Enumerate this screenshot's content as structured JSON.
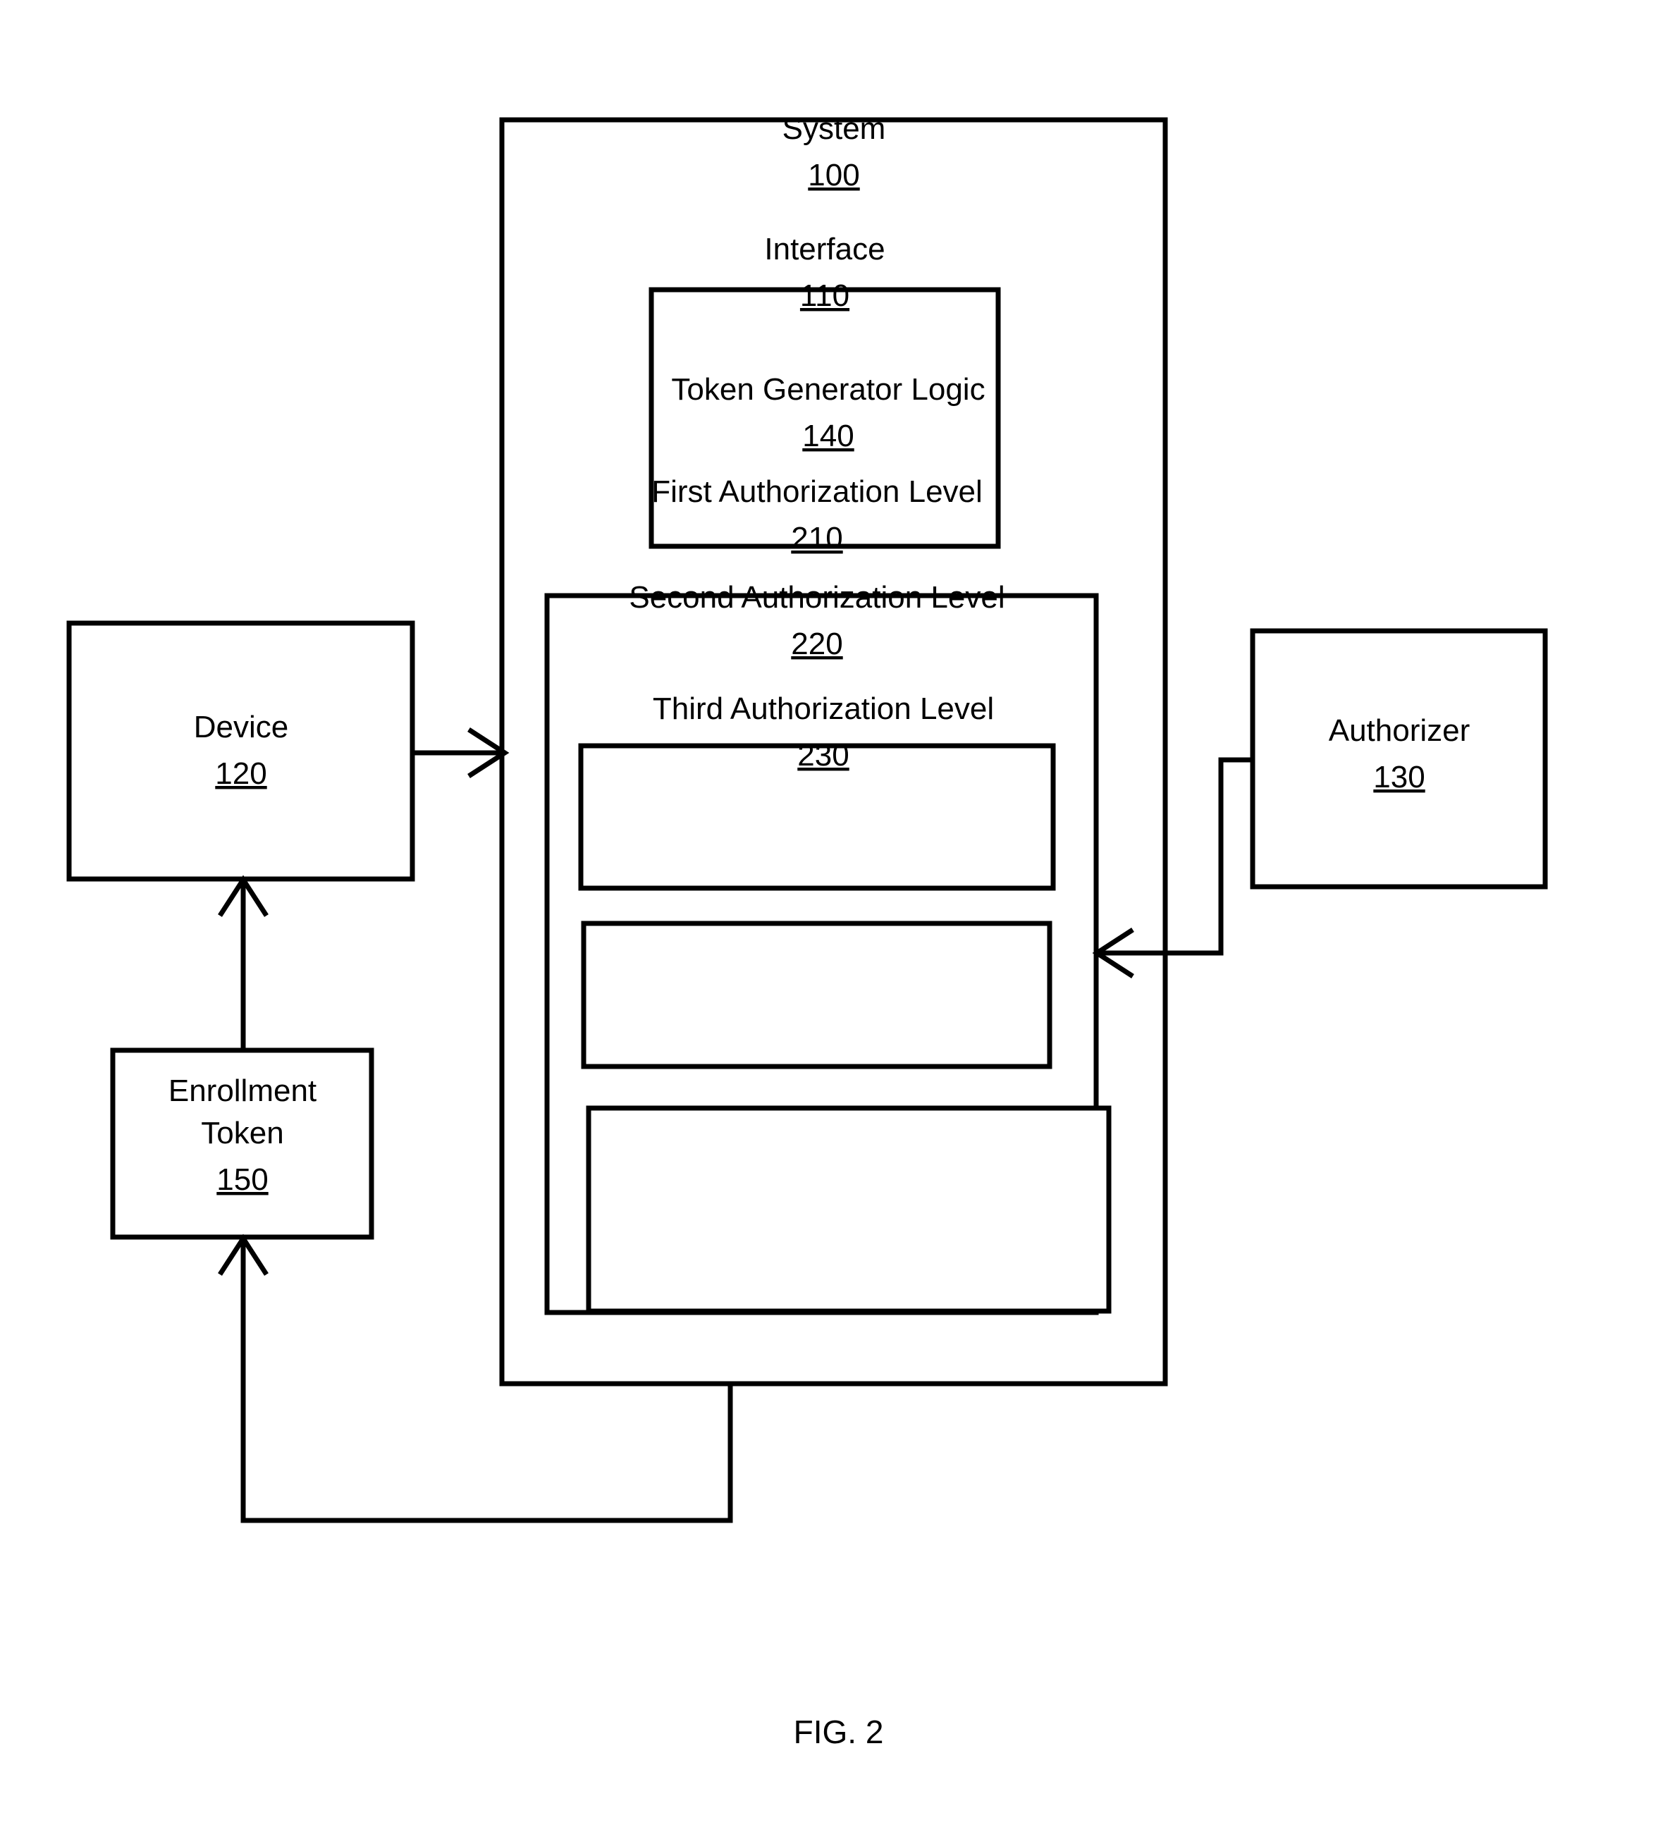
{
  "figure": {
    "caption": "FIG. 2"
  },
  "blocks": {
    "system": {
      "label": "System",
      "ref": "100"
    },
    "interface": {
      "label": "Interface",
      "ref": "110"
    },
    "token_generator_logic": {
      "label": "Token Generator Logic",
      "ref": "140"
    },
    "first_auth_level": {
      "label": "First Authorization Level",
      "ref": "210"
    },
    "second_auth_level": {
      "label": "Second Authorization Level",
      "ref": "220"
    },
    "third_auth_level": {
      "label": "Third Authorization Level",
      "ref": "230"
    },
    "device": {
      "label": "Device",
      "ref": "120"
    },
    "authorizer": {
      "label": "Authorizer",
      "ref": "130"
    },
    "enrollment_token": {
      "label_line1": "Enrollment",
      "label_line2": "Token",
      "ref": "150"
    }
  },
  "connectors": [
    {
      "name": "device-to-system",
      "from": "device",
      "to": "system",
      "arrow": "right"
    },
    {
      "name": "authorizer-to-second-level",
      "from": "authorizer",
      "to": "second_auth_level",
      "arrow": "left"
    },
    {
      "name": "enrollment-token-to-device",
      "from": "enrollment_token",
      "to": "device",
      "arrow": "up"
    },
    {
      "name": "system-to-enrollment-token",
      "from": "system",
      "to": "enrollment_token",
      "arrow": "up"
    }
  ],
  "style": {
    "stroke_color": "#000000",
    "fill_color": "#ffffff",
    "background": "#ffffff"
  }
}
